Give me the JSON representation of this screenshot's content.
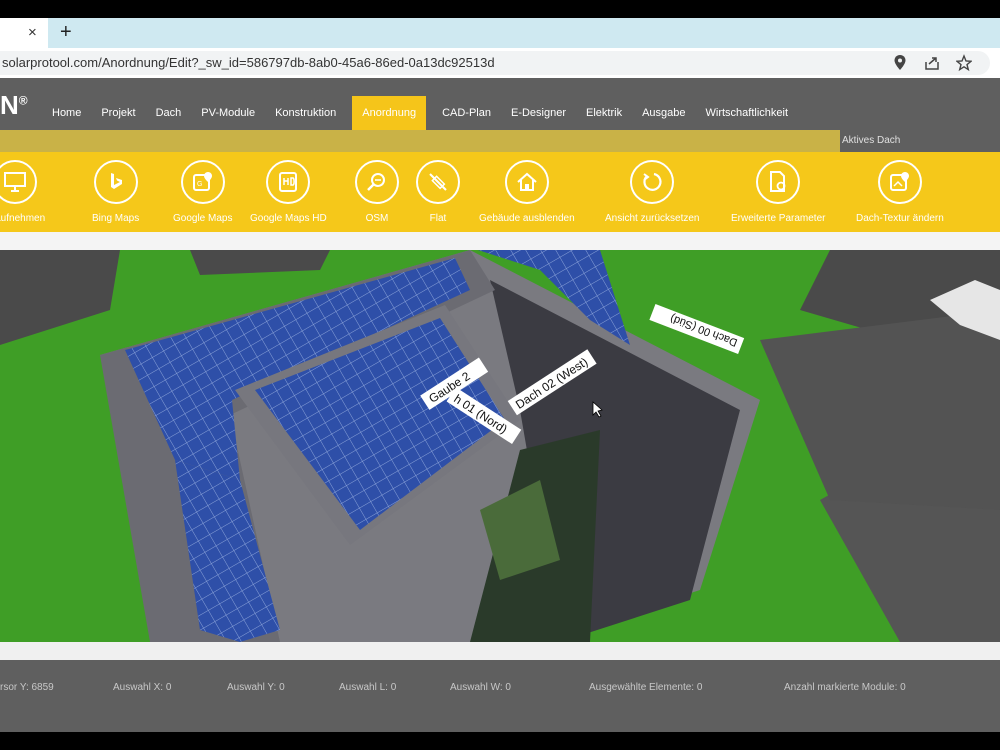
{
  "browser": {
    "tab_close": "×",
    "new_tab": "+",
    "url": "solarprotool.com/Anordnung/Edit?_sw_id=586797db-8ab0-45a6-86ed-0a13dc92513d"
  },
  "app": {
    "logo": "N",
    "logo_mark": "®",
    "nav": [
      "Home",
      "Projekt",
      "Dach",
      "PV-Module",
      "Konstruktion",
      "Anordnung",
      "CAD-Plan",
      "E-Designer",
      "Elektrik",
      "Ausgabe",
      "Wirtschaftlichkeit"
    ],
    "active_nav": "Anordnung",
    "aktives_dach": "Aktives Dach"
  },
  "toolbar": {
    "items": [
      {
        "label": "ht aufnehmen",
        "icon": "monitor-icon"
      },
      {
        "label": "Bing Maps",
        "icon": "bing-icon"
      },
      {
        "label": "Google Maps",
        "icon": "map-pin-icon"
      },
      {
        "label": "Google Maps HD",
        "icon": "map-hd-icon"
      },
      {
        "label": "OSM",
        "icon": "osm-search-icon"
      },
      {
        "label": "Flat",
        "icon": "flat-icon"
      },
      {
        "label": "Gebäude ausblenden",
        "icon": "house-icon"
      },
      {
        "label": "Ansicht zurücksetzen",
        "icon": "reset-view-icon"
      },
      {
        "label": "Erweiterte Parameter",
        "icon": "parameters-icon"
      },
      {
        "label": "Dach-Textur ändern",
        "icon": "texture-icon"
      }
    ]
  },
  "viewport": {
    "labels": {
      "gaube": "Gaube 2",
      "nord": "h 01 (Nord)",
      "west": "Dach 02 (West)",
      "sued": "Dach 00 (Süd)"
    }
  },
  "status": {
    "cursor_y": "rsor Y:",
    "cursor_y_value": "6859",
    "auswahl_x": "Auswahl X:",
    "auswahl_x_value": "0",
    "auswahl_y": "Auswahl Y:",
    "auswahl_y_value": "0",
    "auswahl_l": "Auswahl L:",
    "auswahl_l_value": "0",
    "auswahl_w": "Auswahl W:",
    "auswahl_w_value": "0",
    "ausgewaehlte": "Ausgewählte Elemente:",
    "ausgewaehlte_value": "0",
    "markierte": "Anzahl markierte Module:",
    "markierte_value": "0"
  },
  "colors": {
    "accent": "#f5c81a",
    "grass": "#3f9e26",
    "bar": "#5f5f5f"
  }
}
